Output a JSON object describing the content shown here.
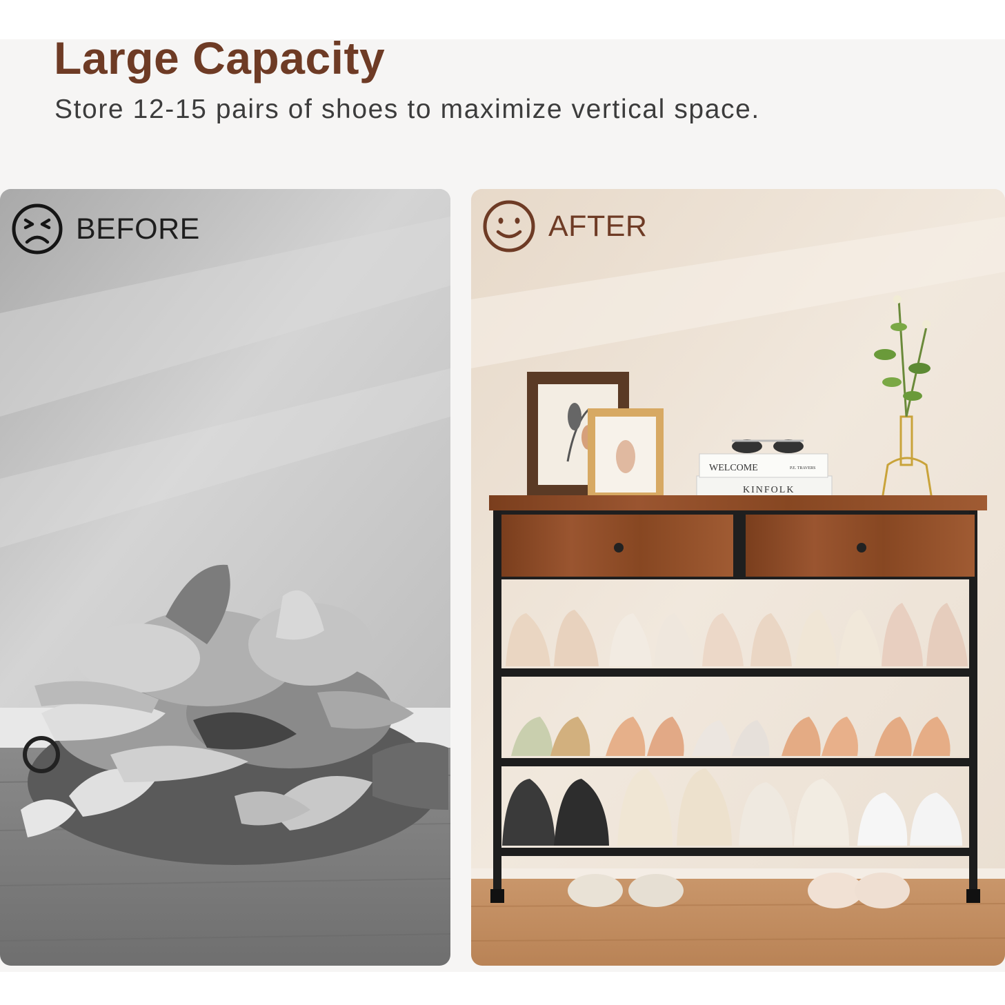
{
  "header": {
    "title": "Large Capacity",
    "subtitle": "Store 12-15 pairs of shoes to maximize vertical space."
  },
  "before_panel": {
    "label": "BEFORE",
    "face_icon": "sad-face-icon"
  },
  "after_panel": {
    "label": "AFTER",
    "face_icon": "smiley-face-icon",
    "book_top_text": "WELCOME",
    "book_top_author": "P.E. TRAVERS",
    "book_bottom_text": "KINFOLK"
  },
  "colors": {
    "brand_brown": "#6e3b25",
    "band_background": "#f6f5f4",
    "before_background": "#c9c9c9",
    "after_background": "#ece2d6",
    "wood": "#8b4a24"
  }
}
